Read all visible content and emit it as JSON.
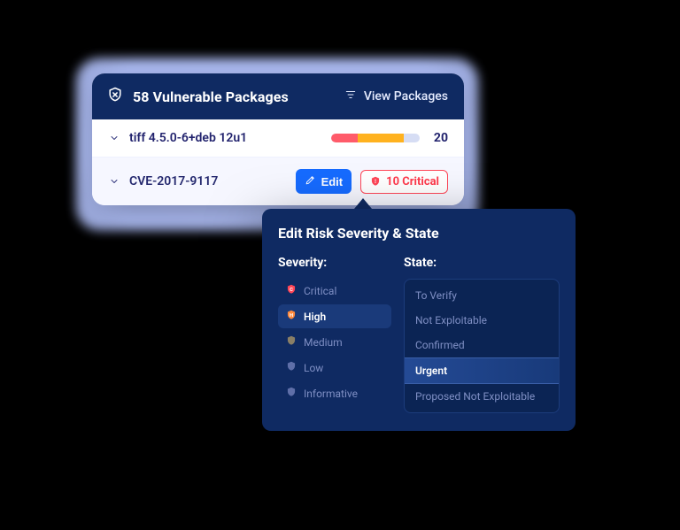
{
  "header": {
    "title": "58 Vulnerable Packages",
    "view_label": "View Packages"
  },
  "package_row": {
    "name": "tiff 4.5.0-6+deb 12u1",
    "count": "20",
    "bar_segments": {
      "red_pct": 30,
      "orange_pct": 52
    }
  },
  "cve_row": {
    "name": "CVE-2017-9117",
    "edit_label": "Edit",
    "critical_badge": "10 Critical"
  },
  "popover": {
    "title": "Edit Risk Severity & State",
    "severity_label": "Severity:",
    "state_label": "State:",
    "severity_options": [
      {
        "key": "critical",
        "label": "Critical",
        "color": "#ff4657",
        "letter": "C",
        "selected": false
      },
      {
        "key": "high",
        "label": "High",
        "color": "#ff8a3d",
        "letter": "H",
        "selected": true
      },
      {
        "key": "medium",
        "label": "Medium",
        "color": "#8a7f66",
        "letter": " ",
        "selected": false
      },
      {
        "key": "low",
        "label": "Low",
        "color": "#5f6fa8",
        "letter": " ",
        "selected": false
      },
      {
        "key": "informative",
        "label": "Informative",
        "color": "#5f6fa8",
        "letter": " ",
        "selected": false
      }
    ],
    "state_options": [
      {
        "key": "to-verify",
        "label": "To Verify",
        "selected": false
      },
      {
        "key": "not-exploitable",
        "label": "Not Exploitable",
        "selected": false
      },
      {
        "key": "confirmed",
        "label": "Confirmed",
        "selected": false
      },
      {
        "key": "urgent",
        "label": "Urgent",
        "selected": true
      },
      {
        "key": "proposed-not-exploitable",
        "label": "Proposed Not Exploitable",
        "selected": false
      }
    ]
  }
}
